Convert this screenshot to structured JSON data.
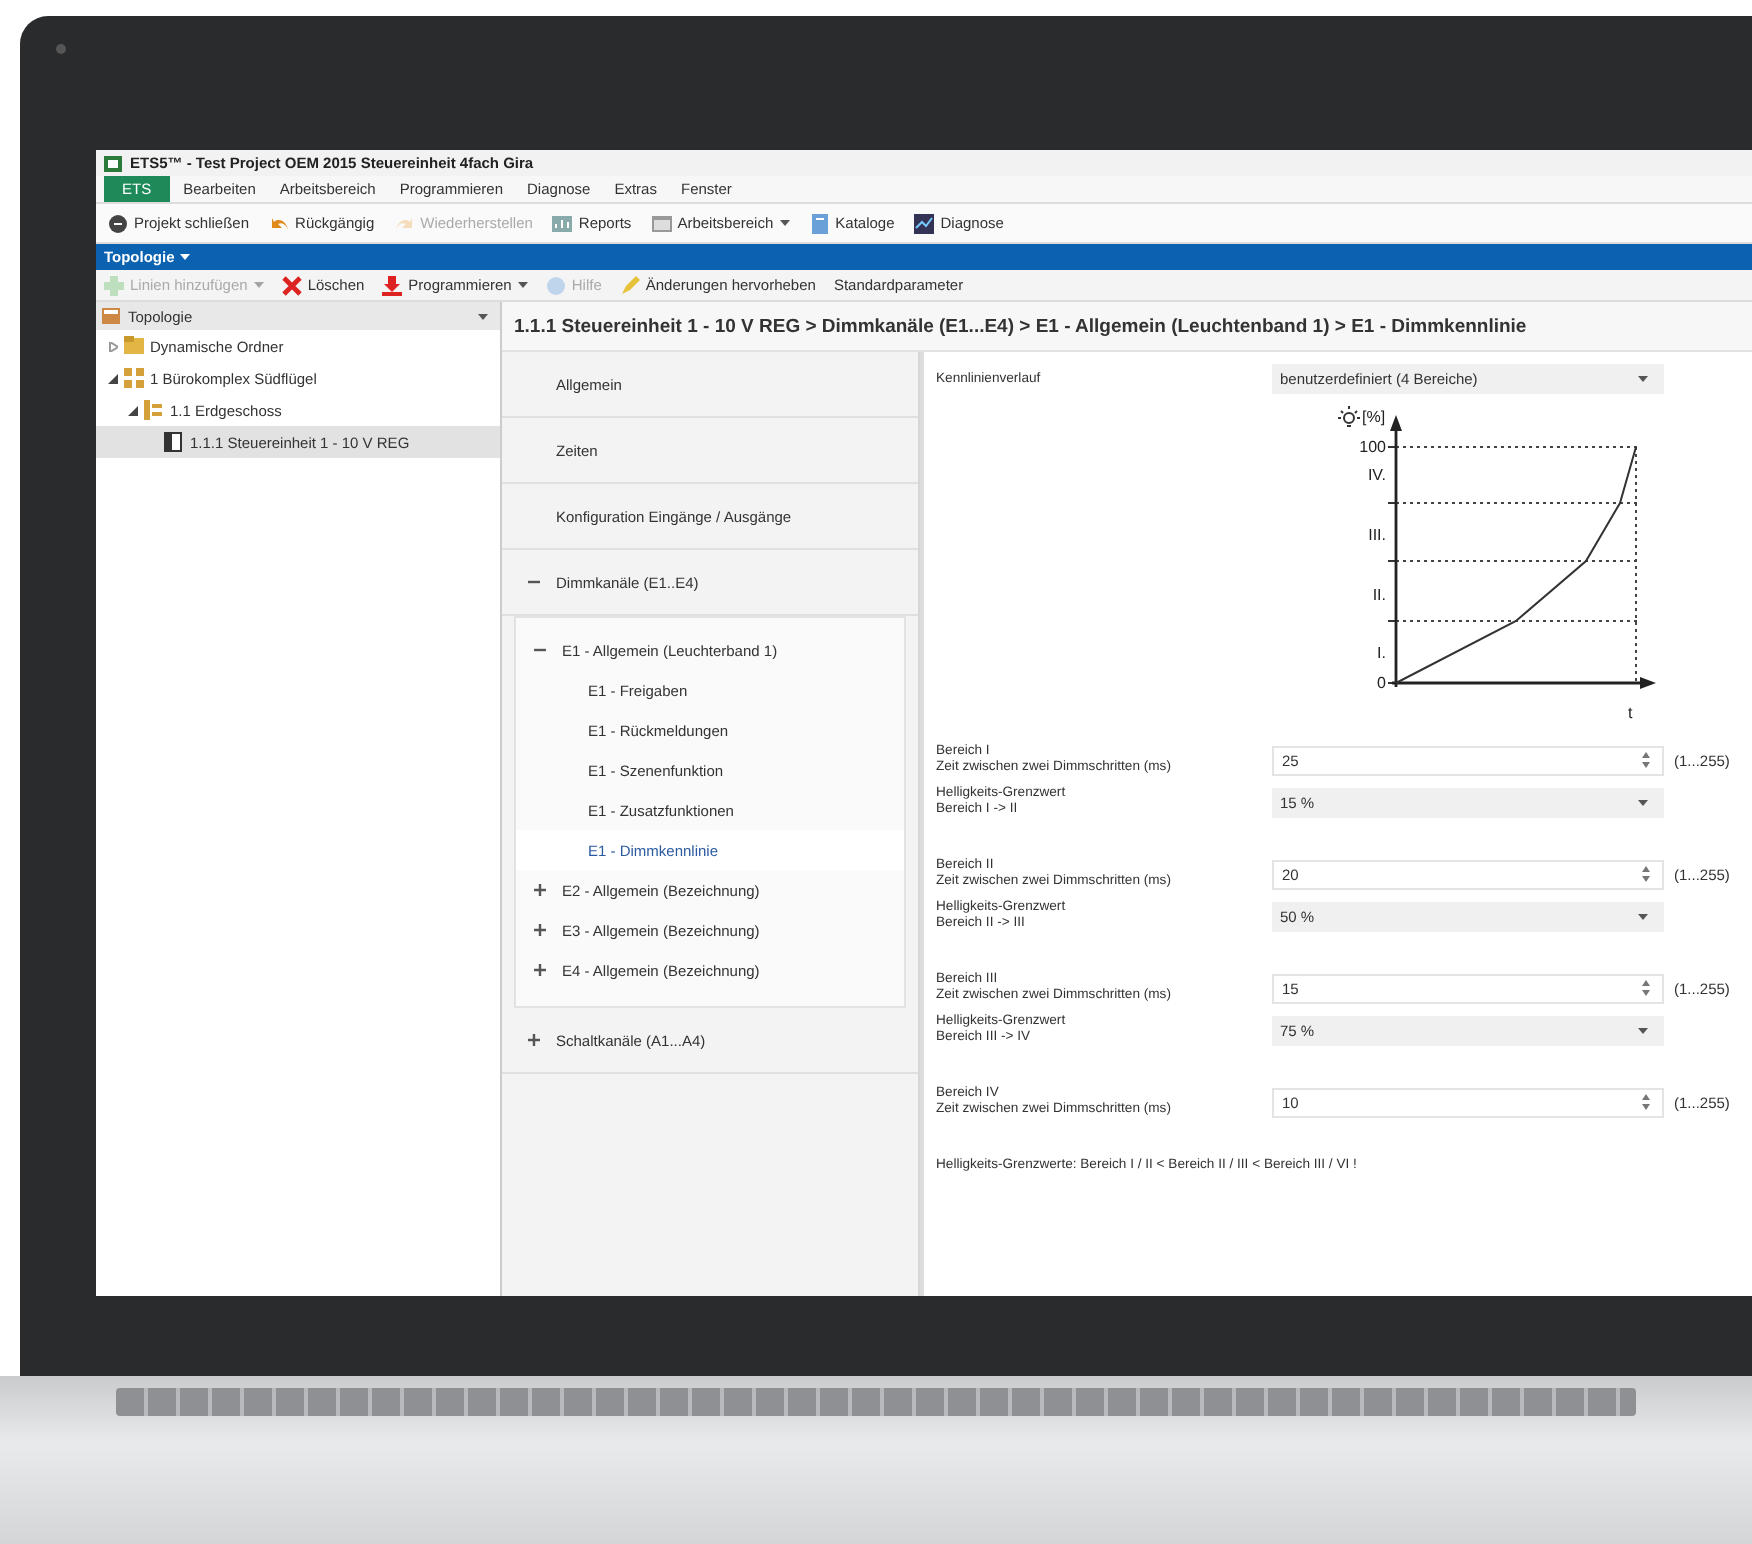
{
  "window": {
    "title": "ETS5™ - Test Project OEM 2015 Steuereinheit 4fach Gira"
  },
  "menu": [
    {
      "label": "ETS",
      "selected": true
    },
    {
      "label": "Bearbeiten",
      "selected": false
    },
    {
      "label": "Arbeitsbereich",
      "selected": false
    },
    {
      "label": "Programmieren",
      "selected": false
    },
    {
      "label": "Diagnose",
      "selected": false
    },
    {
      "label": "Extras",
      "selected": false
    },
    {
      "label": "Fenster",
      "selected": false
    }
  ],
  "toolbar": [
    {
      "label": "Projekt schließen",
      "disabled": false,
      "dropdown": false
    },
    {
      "label": "Rückgängig",
      "disabled": false,
      "dropdown": false
    },
    {
      "label": "Wiederherstellen",
      "disabled": true,
      "dropdown": false
    },
    {
      "label": "Reports",
      "disabled": false,
      "dropdown": false
    },
    {
      "label": "Arbeitsbereich",
      "disabled": false,
      "dropdown": true
    },
    {
      "label": "Kataloge",
      "disabled": false,
      "dropdown": false
    },
    {
      "label": "Diagnose",
      "disabled": false,
      "dropdown": false
    }
  ],
  "view_tab": {
    "label": "Topologie"
  },
  "subtoolbar": [
    {
      "label": "Linien hinzufügen",
      "disabled": true,
      "dropdown": true
    },
    {
      "label": "Löschen",
      "disabled": false,
      "dropdown": false
    },
    {
      "label": "Programmieren",
      "disabled": false,
      "dropdown": true
    },
    {
      "label": "Hilfe",
      "disabled": true,
      "dropdown": false
    },
    {
      "label": "Änderungen hervorheben",
      "disabled": false,
      "dropdown": false
    },
    {
      "label": "Standardparameter",
      "disabled": false,
      "dropdown": false
    }
  ],
  "sidebar": {
    "title": "Topologie",
    "items": [
      {
        "label": "Dynamische Ordner",
        "expanded": false,
        "selected": false
      },
      {
        "label": "1 Bürokomplex Südflügel",
        "expanded": true,
        "selected": false,
        "children": [
          {
            "label": "1.1 Erdgeschoss",
            "expanded": true,
            "selected": false,
            "children": [
              {
                "label": "1.1.1 Steuereinheit 1 - 10 V REG",
                "selected": true
              }
            ]
          }
        ]
      }
    ]
  },
  "breadcrumb": "1.1.1 Steuereinheit 1 - 10 V REG > Dimmkanäle (E1...E4) > E1 - Allgemein (Leuchtenband 1) > E1 - Dimmkennlinie",
  "nav": [
    {
      "label": "Allgemein",
      "selected": false
    },
    {
      "label": "Zeiten",
      "selected": false
    },
    {
      "label": "Konfiguration Eingänge / Ausgänge",
      "selected": false
    },
    {
      "label": "Dimmkanäle (E1..E4)",
      "selected": false,
      "expanded": true,
      "children": [
        {
          "label": "E1 - Allgemein (Leuchterband 1)",
          "selected": false,
          "expanded": true,
          "children": [
            {
              "label": "E1 - Freigaben",
              "selected": false
            },
            {
              "label": "E1 - Rückmeldungen",
              "selected": false
            },
            {
              "label": "E1 - Szenenfunktion",
              "selected": false
            },
            {
              "label": "E1 - Zusatzfunktionen",
              "selected": false
            },
            {
              "label": "E1 - Dimmkennlinie",
              "selected": true
            }
          ]
        },
        {
          "label": "E2 - Allgemein (Bezeichnung)",
          "selected": false,
          "expanded": false
        },
        {
          "label": "E3 - Allgemein (Bezeichnung)",
          "selected": false,
          "expanded": false
        },
        {
          "label": "E4 - Allgemein (Bezeichnung)",
          "selected": false,
          "expanded": false
        }
      ]
    },
    {
      "label": "Schaltkanäle (A1...A4)",
      "selected": false,
      "expanded": false
    }
  ],
  "parameters": [
    {
      "items": [
        {
          "kind": "select",
          "label": "Kennlinienverlauf",
          "value": "benutzerdefiniert (4 Bereiche)"
        },
        {
          "kind": "diagram",
          "unit": "[%]",
          "y_labels": [
            "100",
            "IV.",
            "III.",
            "II.",
            "I.",
            "0"
          ],
          "x_label": "t"
        },
        {
          "kind": "number",
          "label": "Bereich I",
          "sublabel": "Zeit zwischen zwei Dimmschritten (ms)",
          "value": "25",
          "range": "(1...255)"
        },
        {
          "kind": "select",
          "label": "Helligkeits-Grenzwert",
          "sublabel": "Bereich I -> II",
          "value": "15 %"
        }
      ]
    },
    {
      "items": [
        {
          "kind": "number",
          "label": "Bereich II",
          "sublabel": "Zeit zwischen zwei Dimmschritten (ms)",
          "value": "20",
          "range": "(1...255)"
        },
        {
          "kind": "select",
          "label": "Helligkeits-Grenzwert",
          "sublabel": "Bereich II -> III",
          "value": "50 %"
        }
      ]
    },
    {
      "items": [
        {
          "kind": "number",
          "label": "Bereich III",
          "sublabel": "Zeit zwischen zwei Dimmschritten (ms)",
          "value": "15",
          "range": "(1...255)"
        },
        {
          "kind": "select",
          "label": "Helligkeits-Grenzwert",
          "sublabel": "Bereich III -> IV",
          "value": "75 %"
        }
      ]
    },
    {
      "items": [
        {
          "kind": "number",
          "label": "Bereich IV",
          "sublabel": "Zeit zwischen zwei Dimmschritten (ms)",
          "value": "10",
          "range": "(1...255)"
        }
      ]
    },
    {
      "items": [
        {
          "kind": "note",
          "text": "Helligkeits-Grenzwerte: Bereich I / II < Bereich II / III < Bereich III / VI !"
        }
      ]
    }
  ]
}
